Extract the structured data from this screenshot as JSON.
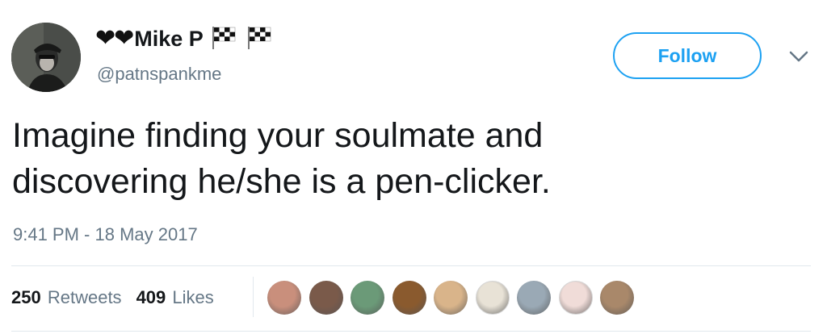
{
  "user": {
    "hearts": "❤❤",
    "display_name": "Mike P",
    "handle": "@patnspankme"
  },
  "actions": {
    "follow_label": "Follow"
  },
  "tweet": {
    "lines": [
      "Imagine finding your soulmate and",
      "discovering he/she is a pen-clicker."
    ],
    "timestamp": "9:41 PM - 18 May 2017"
  },
  "stats": {
    "retweets_count": "250",
    "retweets_label": "Retweets",
    "likes_count": "409",
    "likes_label": "Likes"
  },
  "likers": [
    {
      "icon": "liker-avatar-1",
      "color": "#c98f7c"
    },
    {
      "icon": "liker-avatar-2",
      "color": "#7a5a4a"
    },
    {
      "icon": "liker-avatar-3",
      "color": "#6b9a78"
    },
    {
      "icon": "liker-avatar-4",
      "color": "#8a5a2e"
    },
    {
      "icon": "liker-avatar-5",
      "color": "#d9b48a"
    },
    {
      "icon": "liker-avatar-6",
      "color": "#e8e2d6"
    },
    {
      "icon": "liker-avatar-7",
      "color": "#9aa9b5"
    },
    {
      "icon": "liker-avatar-8",
      "color": "#f0dcd8"
    },
    {
      "icon": "liker-avatar-9",
      "color": "#a9886a"
    }
  ],
  "colors": {
    "accent": "#1da1f2",
    "secondary_text": "#657786",
    "primary_text": "#14171a",
    "divider": "#e1e8ed"
  }
}
